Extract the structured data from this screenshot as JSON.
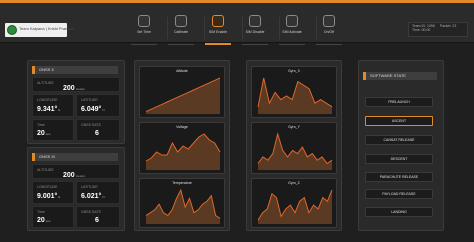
{
  "header": {
    "team_text": "Team Kalpana | Krishi Pranaan",
    "nav": [
      {
        "label": "Set Time"
      },
      {
        "label": "Calibrate"
      },
      {
        "label": "SIM Enable"
      },
      {
        "label": "SIM Disable"
      },
      {
        "label": "SIM Activate"
      },
      {
        "label": "On/Off"
      }
    ],
    "active_nav_index": 2,
    "status": {
      "team_id": "Team ID: 1056",
      "packet": "Packet: 23",
      "time": "Time: 00:00"
    }
  },
  "gnss": [
    {
      "title": "GNSS II",
      "altitude_label": "ALTITUDE",
      "altitude_value": "200",
      "altitude_unit": "meters",
      "longitude_label": "LONGITUDE",
      "longitude_value": "9.341°",
      "longitude_unit": "E",
      "latitude_label": "LATITUDE",
      "latitude_value": "6.049°",
      "latitude_unit": "N",
      "time_label": "Time",
      "time_value": "20",
      "time_unit": "sec",
      "sats_label": "GNSS SATS",
      "sats_value": "6"
    },
    {
      "title": "GNSS III",
      "altitude_label": "ALTITUDE",
      "altitude_value": "200",
      "altitude_unit": "meters",
      "longitude_label": "LONGITUDE",
      "longitude_value": "9.001°",
      "longitude_unit": "E",
      "latitude_label": "LATITUDE",
      "latitude_value": "6.021°",
      "latitude_unit": "N",
      "time_label": "Time",
      "time_value": "20",
      "time_unit": "sec",
      "sats_label": "GNSS SATS",
      "sats_value": "6"
    }
  ],
  "charts": [
    {
      "title": "Altitude",
      "values": [
        1,
        2,
        3,
        4,
        5,
        6,
        7,
        8,
        9,
        10,
        11,
        12,
        13,
        14,
        15
      ]
    },
    {
      "title": "Voltage",
      "values": [
        3,
        4,
        6,
        5,
        5,
        9,
        6,
        8,
        7,
        9,
        11,
        12,
        10,
        9,
        6
      ]
    },
    {
      "title": "Temperature",
      "values": [
        3,
        4,
        5,
        7,
        4,
        3,
        5,
        9,
        12,
        6,
        9,
        4,
        5,
        7,
        8,
        10,
        3,
        2
      ]
    },
    {
      "title": "Gyro_X",
      "values": [
        2,
        10,
        3,
        6,
        4,
        5,
        4,
        9,
        8,
        7,
        3,
        4,
        3,
        2
      ]
    },
    {
      "title": "Gyro_Y",
      "values": [
        2,
        4,
        3,
        5,
        11,
        6,
        4,
        6,
        5,
        7,
        4,
        5,
        3,
        4,
        2,
        3
      ]
    },
    {
      "title": "Gyro_Z",
      "values": [
        1,
        3,
        4,
        8,
        7,
        2,
        4,
        5,
        3,
        6,
        7,
        3,
        5,
        4,
        7,
        6,
        9
      ]
    }
  ],
  "software_state": {
    "title": "SOFTWARE STATE",
    "states": [
      "PRELAUNCH",
      "ASCENT",
      "CANSAT RELEASE",
      "DESCENT",
      "PARACHUTE RELEASE",
      "PAYLOAD RELEASE",
      "LANDING"
    ],
    "active_index": 1
  },
  "colors": {
    "accent": "#e08a2a",
    "line": "#e0662d",
    "fill": "#5a3a22",
    "panel": "#2a2a2a",
    "bg": "#1f1f1f"
  }
}
